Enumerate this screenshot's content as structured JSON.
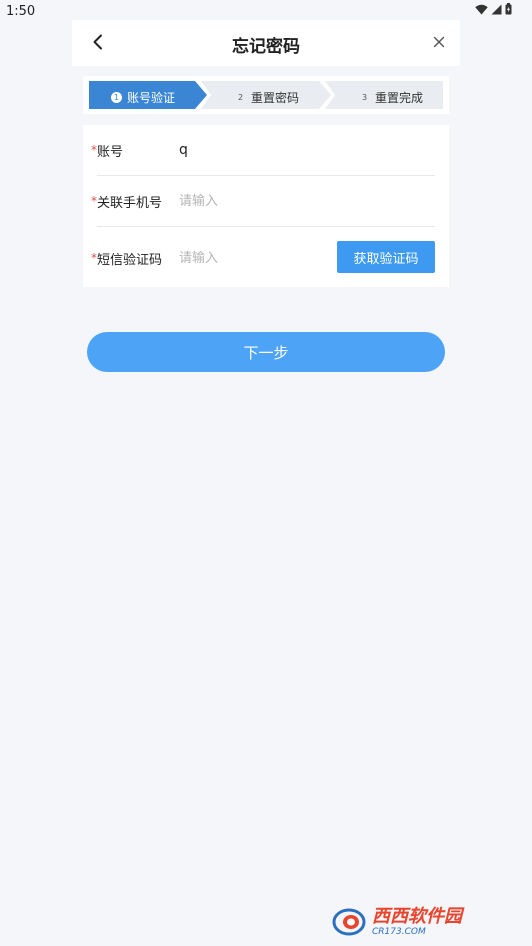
{
  "status_bar": {
    "time": "1:50",
    "icons": [
      "wifi-icon",
      "signal-icon",
      "battery-icon"
    ]
  },
  "header": {
    "title": "忘记密码",
    "back_icon": "chevron-left-icon",
    "close_icon": "close-icon"
  },
  "steps": [
    {
      "number": "1",
      "label": "账号验证",
      "active": true
    },
    {
      "number": "2",
      "label": "重置密码",
      "active": false
    },
    {
      "number": "3",
      "label": "重置完成",
      "active": false
    }
  ],
  "form": {
    "required_mark": "*",
    "account": {
      "label": "账号",
      "value": "q",
      "placeholder": ""
    },
    "phone": {
      "label": "关联手机号",
      "value": "",
      "placeholder": "请输入"
    },
    "sms_code": {
      "label": "短信验证码",
      "value": "",
      "placeholder": "请输入",
      "button_label": "获取验证码"
    }
  },
  "next_button": {
    "label": "下一步"
  },
  "watermark": {
    "brand": "西西软件园",
    "url": "CR173.COM"
  },
  "colors": {
    "primary": "#4da3f5",
    "step_active": "#3a86d4",
    "step_inactive": "#e9ecf0",
    "required": "#d9534f",
    "background": "#f4f6f9"
  }
}
